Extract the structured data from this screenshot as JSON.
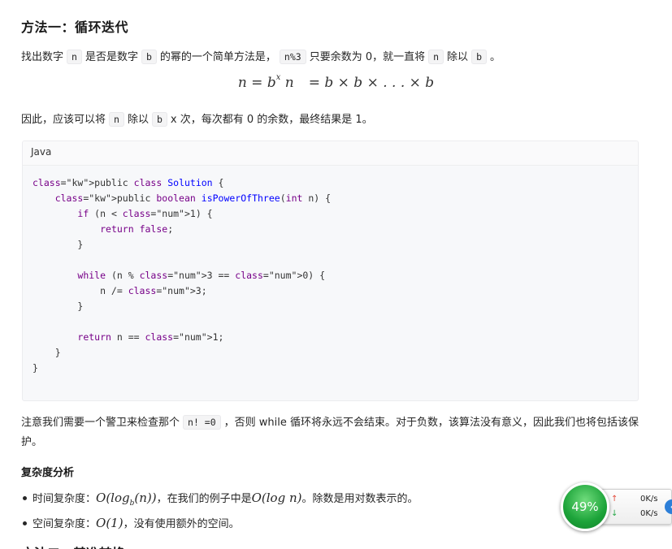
{
  "article": {
    "section_title": "方法一：循环迭代",
    "intro": {
      "t1": "找出数字",
      "c1": "n",
      "t2": "是否是数字",
      "c2": "b",
      "t3": "的幂的一个简单方法是，",
      "c3": "n%3",
      "t4": "只要余数为 0，就一直将",
      "c4": "n",
      "t5": "除以",
      "c5": "b",
      "t6": "。"
    },
    "formula": {
      "lhs": "n = b",
      "exp": "x",
      "var": "n",
      "rhs": "= b × b × . . . × b"
    },
    "conclusion": {
      "t1": "因此，应该可以将",
      "c1": "n",
      "t2": "除以",
      "c2": "b",
      "t3": "x 次，每次都有 0 的余数，最终结果是 1。"
    },
    "code": {
      "language": "Java",
      "lines": [
        "public class Solution {",
        "    public boolean isPowerOfThree(int n) {",
        "        if (n < 1) {",
        "            return false;",
        "        }",
        "",
        "        while (n % 3 == 0) {",
        "            n /= 3;",
        "        }",
        "",
        "        return n == 1;",
        "    }",
        "}"
      ]
    },
    "note": {
      "t1": "注意我们需要一个警卫来检查那个",
      "c1": "n! =0",
      "t2": "，否则 while 循环将永远不会结束。对于负数，该算法没有意义，因此我们也将包括该保护。"
    },
    "complexity": {
      "title": "复杂度分析",
      "time_label": "时间复杂度：",
      "time_formula_main": "O(log",
      "time_formula_sub": "b",
      "time_formula_end": "(n))",
      "time_mid": "，在我们的例子中是",
      "time_formula2": "O(log n)",
      "time_tail": "。除数是用对数表示的。",
      "space_label": "空间复杂度：",
      "space_formula": "O(1)",
      "space_tail": "，没有使用额外的空间。"
    },
    "next_section_title": "方法二：基准转换"
  },
  "speed_widget": {
    "cpu_percent_label": "49%",
    "cpu_percent": 49,
    "upload_arrow": "↑",
    "upload": "0K/s",
    "download_arrow": "↓",
    "download": "0K/s",
    "side_button": "‹",
    "colors": {
      "ring": "#1ca339",
      "up": "#e24a3b",
      "down": "#2aa84a",
      "button": "#2d7fd8"
    }
  }
}
